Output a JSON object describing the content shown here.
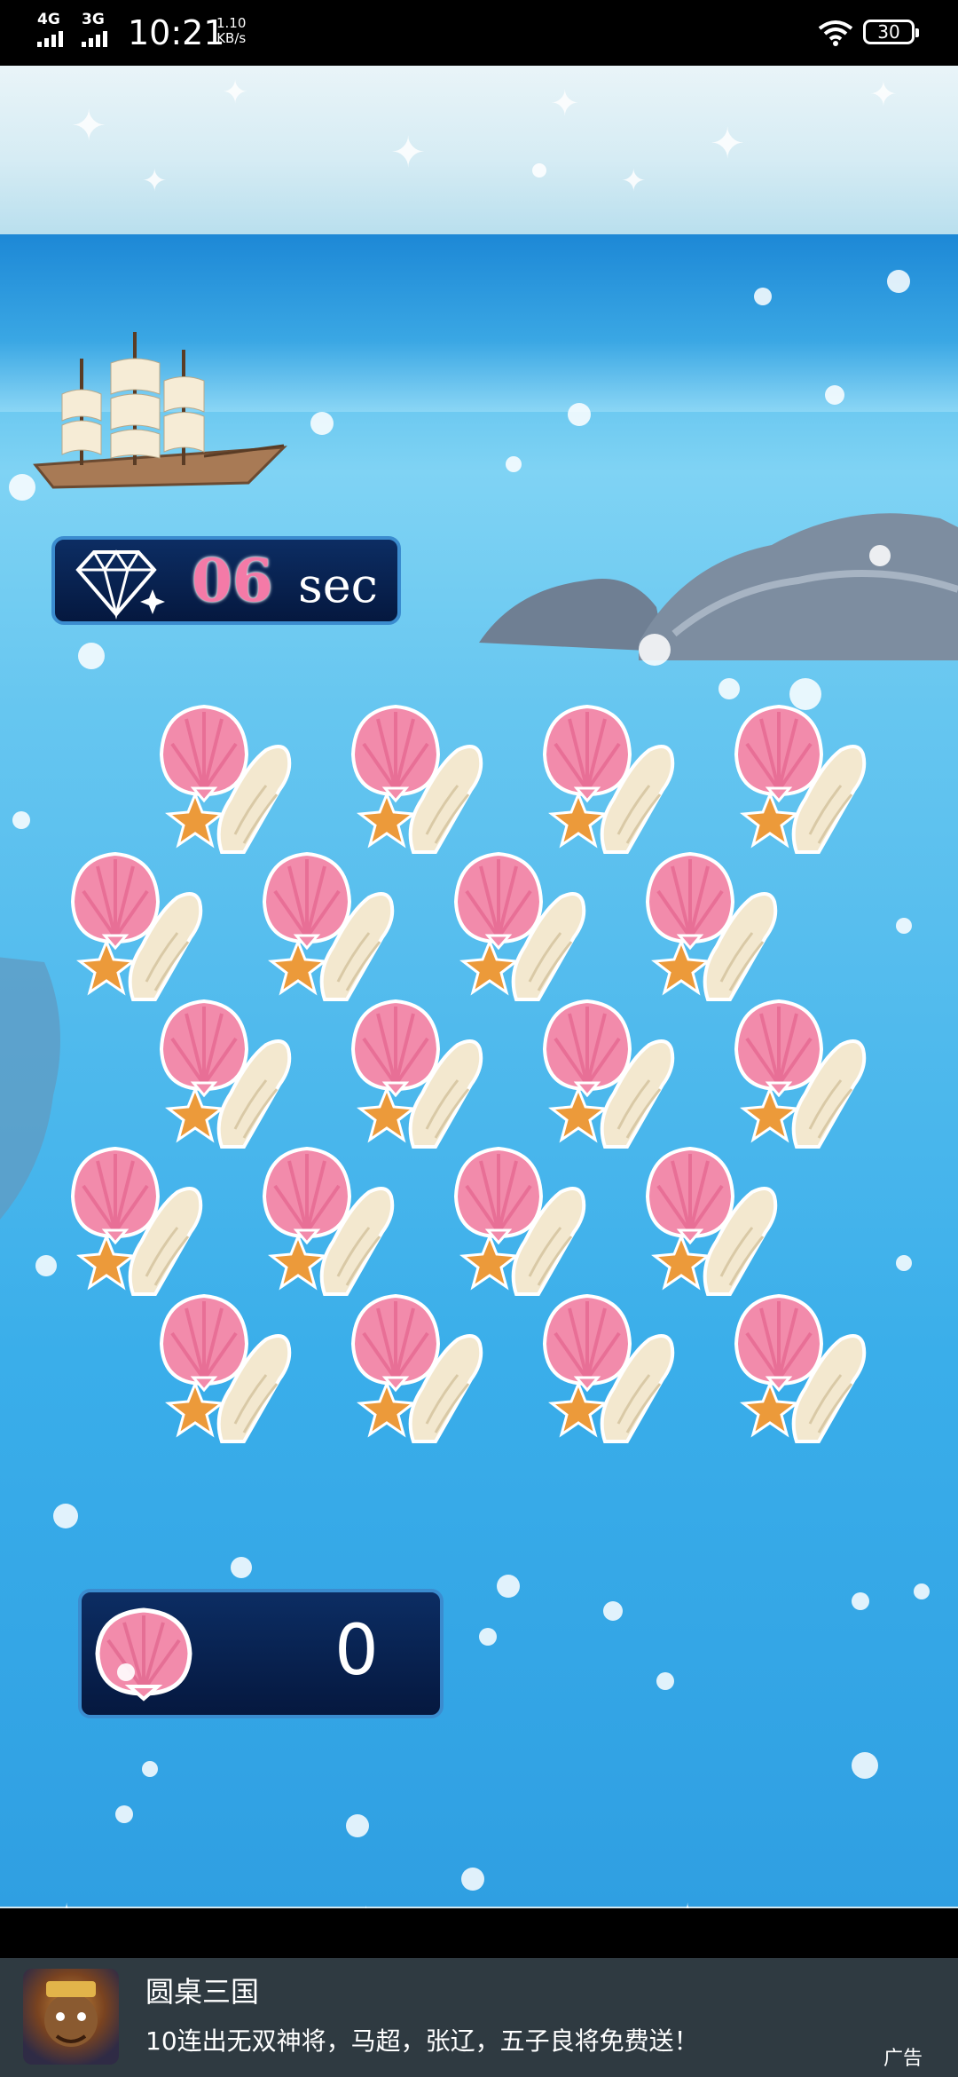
{
  "status_bar": {
    "signal_1": "4G",
    "signal_2": "3G",
    "time": "10:21",
    "net_speed_value": "1.10",
    "net_speed_unit": "KB/s",
    "battery": "30"
  },
  "game": {
    "timer": {
      "value": "06",
      "unit": "sec",
      "icon": "diamond-icon"
    },
    "score": {
      "value": "0",
      "icon": "scallop-shell-icon"
    },
    "board": {
      "rows": 5,
      "columns": 4,
      "tile": "scallop-starfish-conch"
    },
    "colors": {
      "panel": "#05183f",
      "panel_border": "#3b8ccf",
      "timer_digits": "#f47aa7",
      "shell_pink": "#f28bab",
      "conch": "#f3e8cf",
      "starfish": "#ec9a3a"
    }
  },
  "ad": {
    "title": "圆桌三国",
    "description": "10连出无双神将，马超，张辽，五子良将免费送！",
    "label": "广告"
  }
}
